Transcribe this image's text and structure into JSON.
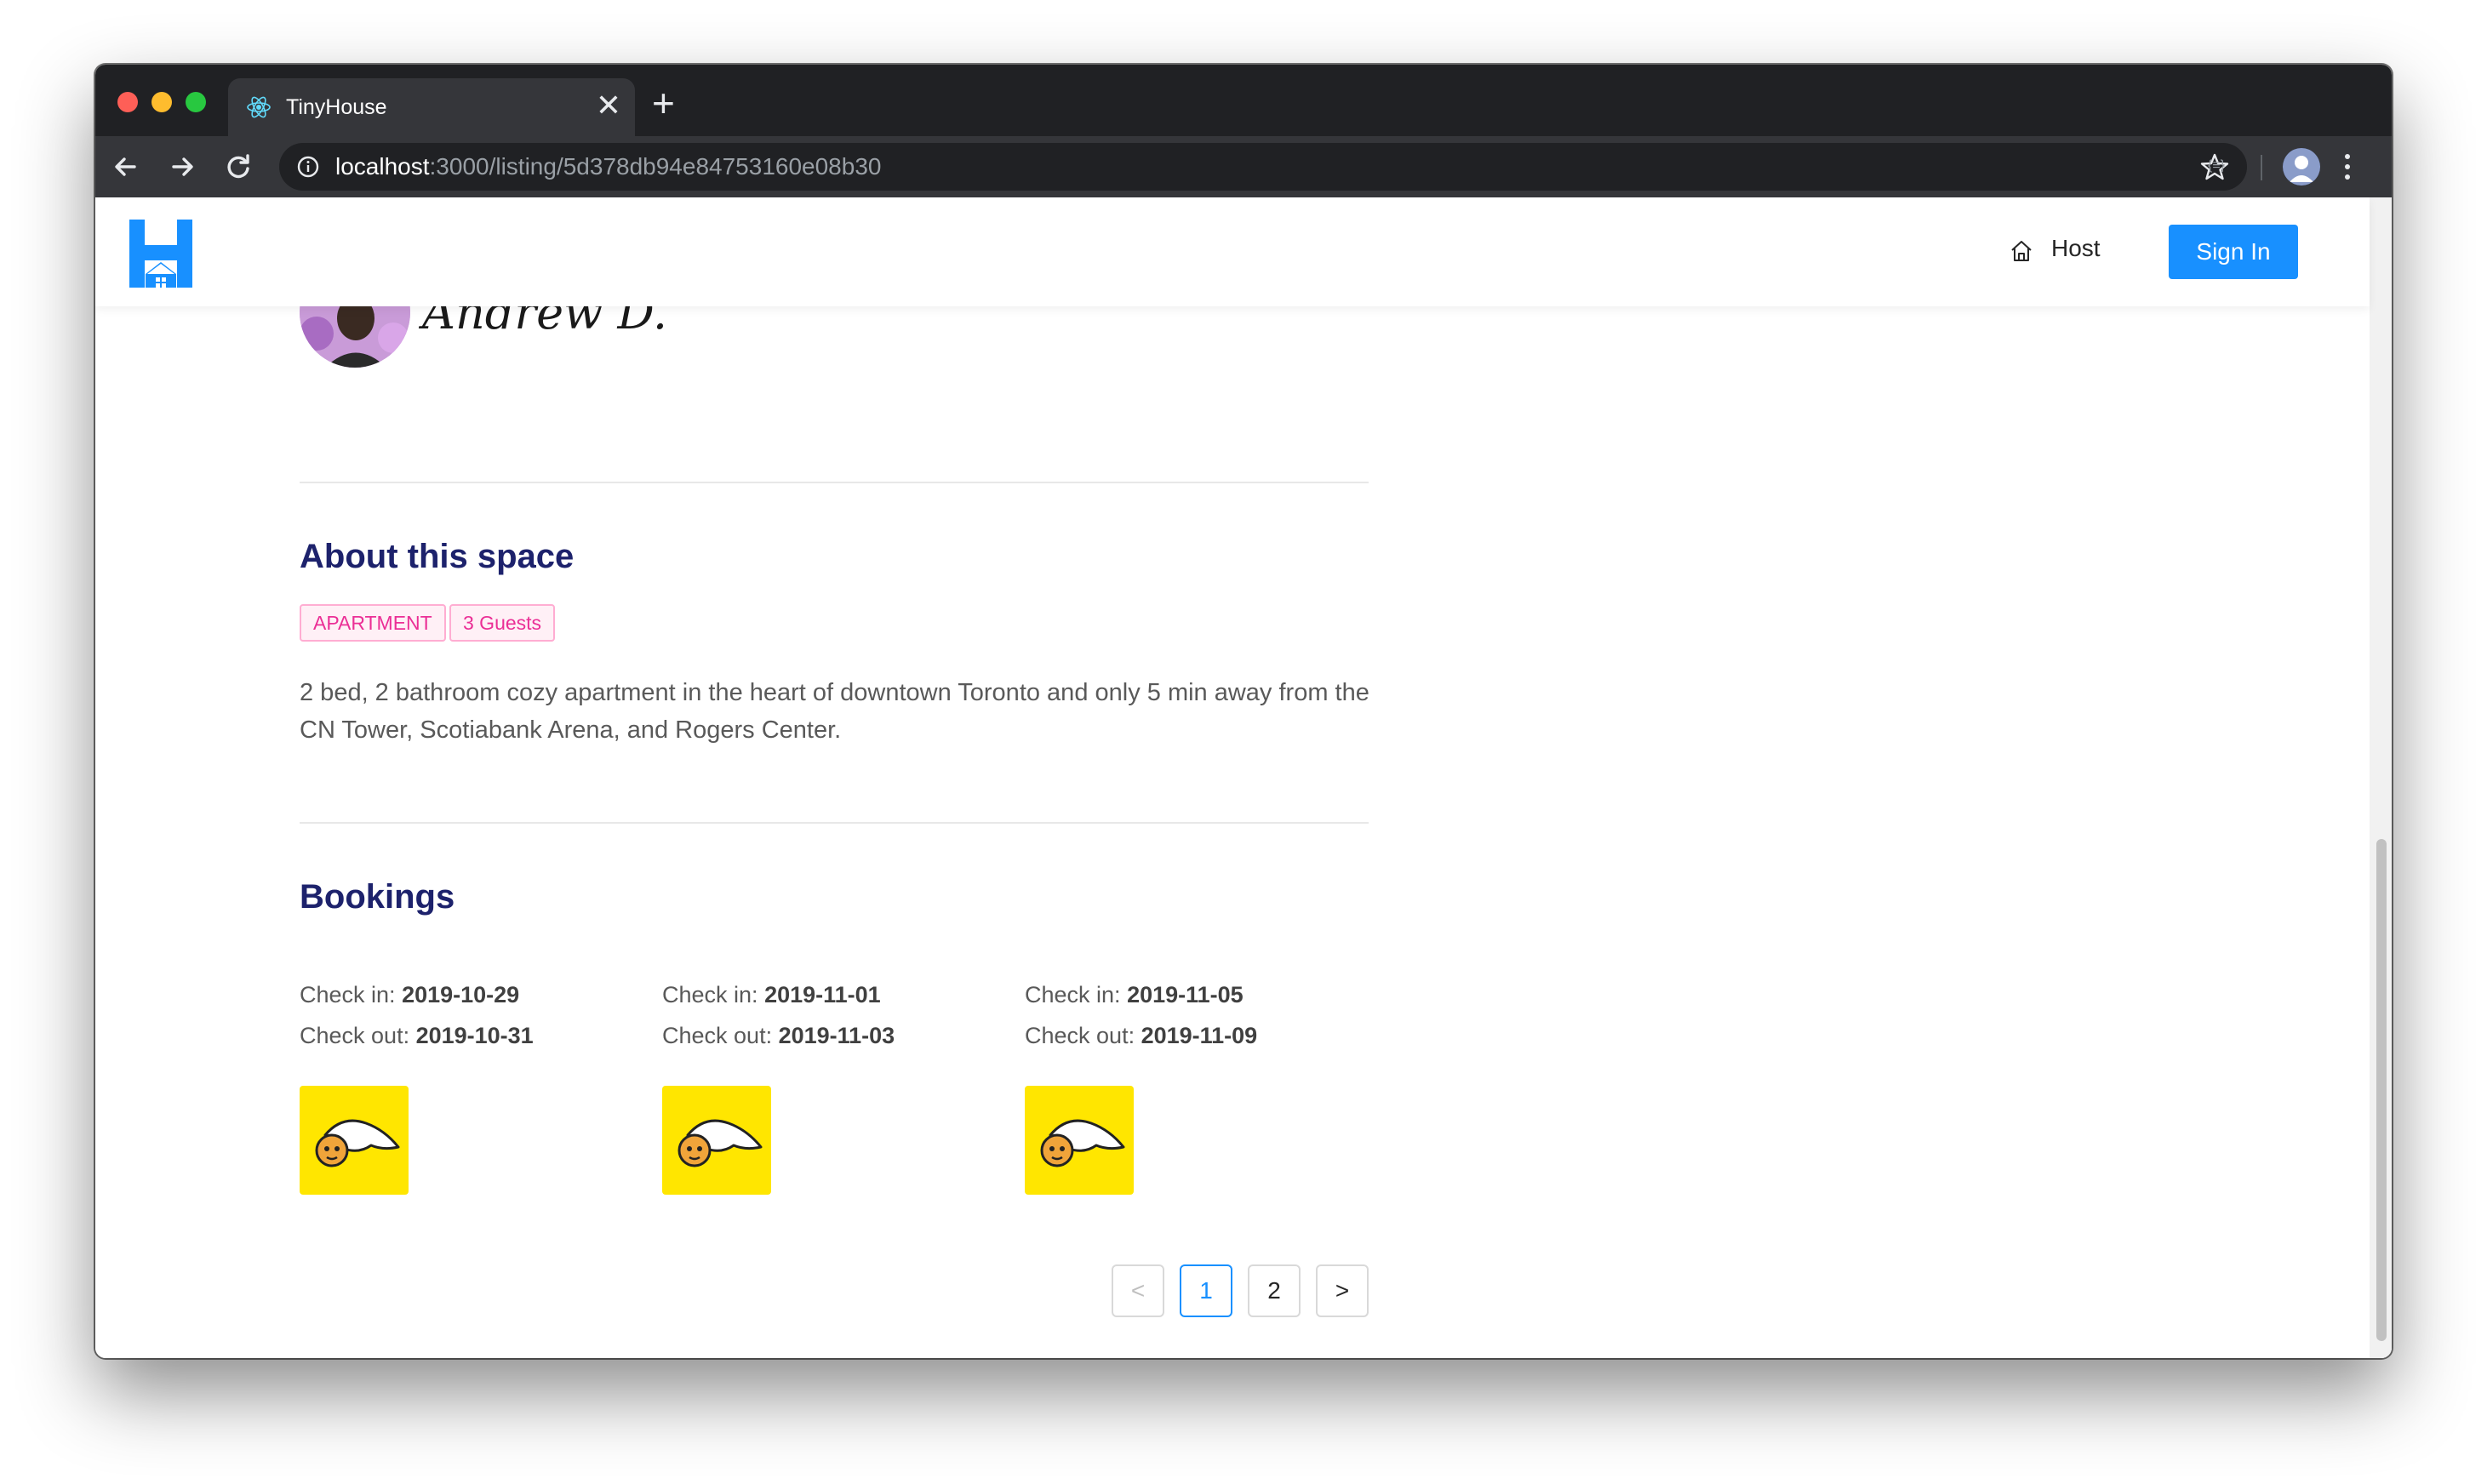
{
  "browser": {
    "tab_title": "TinyHouse",
    "tab_close": "✕",
    "new_tab": "+",
    "url_host": "localhost",
    "url_path": ":3000/listing/5d378db94e84753160e08b30",
    "extension_label": "{≡}"
  },
  "header": {
    "host_label": "Host",
    "signin_label": "Sign In",
    "brand_color": "#1890ff"
  },
  "listing": {
    "host_name": "Andrew D.",
    "about_heading": "About this space",
    "tags": [
      "APARTMENT",
      "3 Guests"
    ],
    "description": "2 bed, 2 bathroom cozy apartment in the heart of downtown Toronto and only 5 min away from the CN Tower, Scotiabank Arena, and Rogers Center."
  },
  "bookings": {
    "heading": "Bookings",
    "check_in_label": "Check in: ",
    "check_out_label": "Check out: ",
    "items": [
      {
        "check_in": "2019-10-29",
        "check_out": "2019-10-31"
      },
      {
        "check_in": "2019-11-01",
        "check_out": "2019-11-03"
      },
      {
        "check_in": "2019-11-05",
        "check_out": "2019-11-09"
      }
    ]
  },
  "pagination": {
    "prev": "<",
    "pages": [
      "1",
      "2"
    ],
    "current": "1",
    "next": ">"
  }
}
